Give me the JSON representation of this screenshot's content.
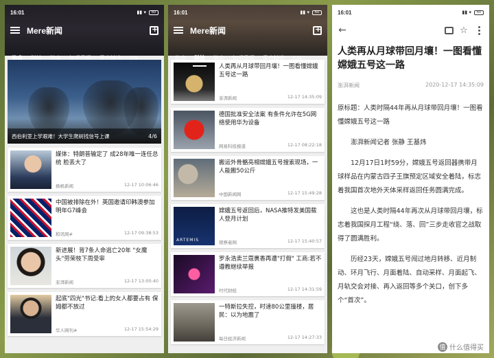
{
  "status": {
    "time": "16:01",
    "signal": "▮▮ ▾",
    "battery": "60"
  },
  "app": {
    "title": "Mere新闻"
  },
  "tabs": [
    "热点",
    "科技",
    "独家",
    "知乎日报",
    "果壳精选",
    "CN"
  ],
  "panel1": {
    "hero": {
      "caption": "西伯利亚上学艰难！大学生爬树找信号上课",
      "pager": "4/6"
    },
    "cards": [
      {
        "title": "媒体：特朗普输定了 成28年唯一连任总统 脸丢大了",
        "source": "扬帆新闻",
        "time": "12-17 10:06:46"
      },
      {
        "title": "中国被排除在外！英国邀请印韩澳参加明年G7峰会",
        "source": "和讯网#",
        "time": "12-17 09:38:53"
      },
      {
        "title": "新进展！背7条人命逃亡20年 \"女魔头\"劳荣枝下周受审",
        "source": "澎湃新闻",
        "time": "12-17 13:00:40"
      },
      {
        "title": "起底\"四光\"书记:看上的女人都要占有 保姆都不放过",
        "source": "华人网刊#",
        "time": "12-17 15:54:29"
      }
    ]
  },
  "panel2": {
    "cards": [
      {
        "title": "人类再从月球带回月壤！一图看懂嫦娥五号这一路",
        "source": "澎湃新闻",
        "time": "12-17 14:35:09"
      },
      {
        "title": "德国批准安全法案 有条件允许在5G网络使用华为设备",
        "source": "网易科技报道",
        "time": "12-17 08:22:18"
      },
      {
        "title": "搬运外骨骼亮相嫦娥五号搜索现场，一人能搬50公斤",
        "source": "中国新闻网",
        "time": "12-17 15:49:28"
      },
      {
        "title": "嫦娥五号返回后，NASA推特发美国载人登月计划",
        "source": "观察者网",
        "time": "12-17 15:40:57"
      },
      {
        "title": "罗永浩卖兰蔻裹香再遭\"打假\" 工商:若不遵教继续举报",
        "source": "时代财经",
        "time": "12-17 14:31:59"
      },
      {
        "title": "一特斯拉失控，时速80公里撞楼，居民：以为地震了",
        "source": "每日经济新闻",
        "time": "12-17 14:27:33"
      }
    ],
    "artemis_caption": "ARTEMIS"
  },
  "article": {
    "title": "人类再从月球带回月壤！一图看懂嫦娥五号这一路",
    "source": "澎湃新闻",
    "time": "2020-12-17 14:35:09",
    "p1": "原标题：人类时隔44年再从月球带回月壤！一图看懂嫦娥五号这一路",
    "p2": "澎湃新闻记者 张静 王基炜",
    "p3": "12月17日1时59分，嫦娥五号返回器携带月球样品在内蒙古四子王旗预定区域安全着陆，标志着我国首次地外天体采样返回任务圆满完成。",
    "p4": "这也是人类时隔44年再次从月球带回月壤，标志着我国探月工程“绕、落、回”三步走收官之战取得了圆满胜利。",
    "p5": "历经23天，嫦娥五号闯过地月转移、近月制动、环月飞行、月面着陆、自动采样、月面起飞、月轨交会对接、再入返回等多个关口，创下多个“首次”。",
    "watermark_badge": "值",
    "watermark": "什么值得买"
  }
}
